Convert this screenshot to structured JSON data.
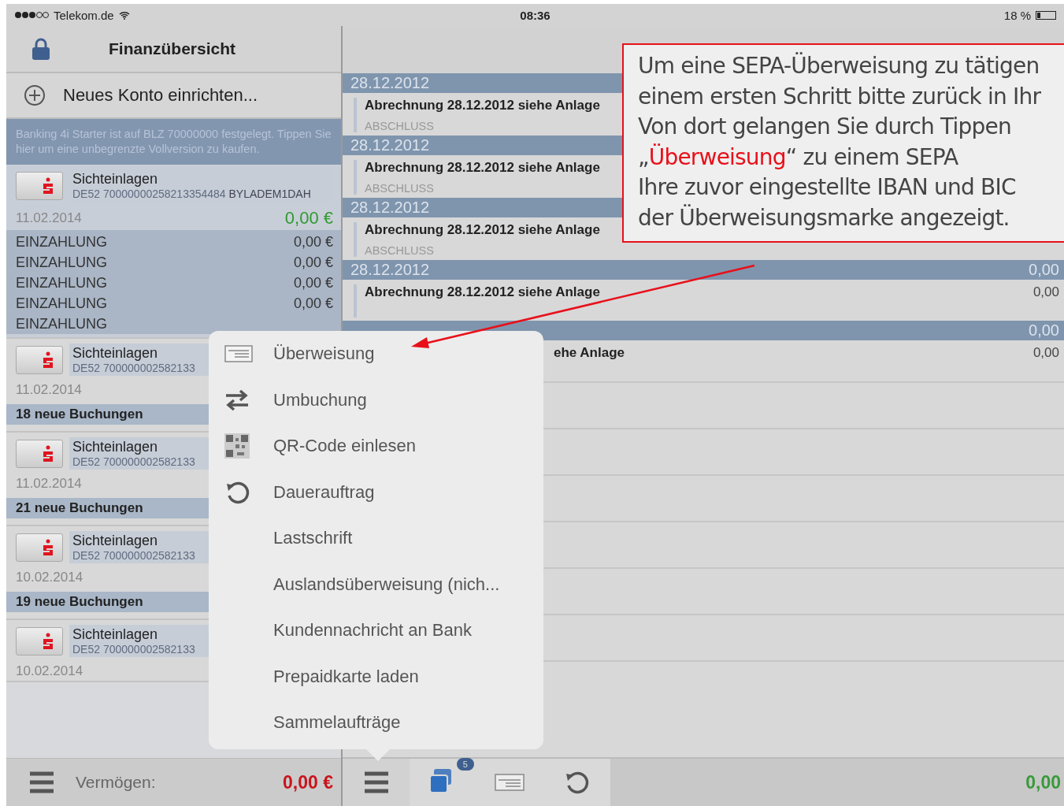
{
  "status_bar": {
    "carrier": "Telekom.de",
    "time": "08:36",
    "battery": "18 %"
  },
  "sidebar": {
    "title": "Finanzübersicht",
    "add_account": "Neues Konto einrichten...",
    "banner": "Banking 4i Starter ist auf BLZ 70000000 festgelegt. Tippen Sie hier um eine unbegrenzte Vollversion zu kaufen.",
    "accounts": [
      {
        "name": "Sichteinlagen",
        "iban": "DE52 70000000258213354484",
        "bic": "BYLADEM1DAH",
        "date": "11.02.2014",
        "balance": "0,00 €",
        "expanded": true,
        "transactions": [
          {
            "label": "EINZAHLUNG",
            "amount": "0,00 €"
          },
          {
            "label": "EINZAHLUNG",
            "amount": "0,00 €"
          },
          {
            "label": "EINZAHLUNG",
            "amount": "0,00 €"
          },
          {
            "label": "EINZAHLUNG",
            "amount": "0,00 €"
          },
          {
            "label": "EINZAHLUNG"
          }
        ]
      },
      {
        "name": "Sichteinlagen",
        "iban": "DE52 700000002582133",
        "date": "11.02.2014",
        "expanded": false,
        "new_bookings": "18 neue Buchungen"
      },
      {
        "name": "Sichteinlagen",
        "iban": "DE52 700000002582133",
        "date": "11.02.2014",
        "expanded": false,
        "new_bookings": "21 neue Buchungen"
      },
      {
        "name": "Sichteinlagen",
        "iban": "DE52 700000002582133",
        "date": "10.02.2014",
        "expanded": false,
        "new_bookings": "19 neue Buchungen"
      },
      {
        "name": "Sichteinlagen",
        "iban": "DE52 700000002582133",
        "date": "10.02.2014",
        "expanded": false
      }
    ],
    "footer": {
      "label": "Vermögen:",
      "total": "0,00 €"
    }
  },
  "main": {
    "sections": [
      {
        "date": "28.12.2012",
        "rows": [
          {
            "title": "Abrechnung 28.12.2012 siehe Anlage",
            "subtitle": "ABSCHLUSS",
            "partial": false
          }
        ]
      },
      {
        "date": "28.12.2012",
        "rows": [
          {
            "title": "Abrechnung 28.12.2012 siehe Anlage",
            "subtitle": "ABSCHLUSS",
            "partial": false
          }
        ]
      },
      {
        "date": "28.12.2012",
        "rows": [
          {
            "title": "Abrechnung 28.12.2012 siehe Anlage",
            "subtitle": "ABSCHLUSS",
            "partial": false
          }
        ]
      },
      {
        "date": "28.12.2012",
        "amount": "0,00",
        "rows": [
          {
            "title": "Abrechnung 28.12.2012 siehe Anlage",
            "amount": "0,00",
            "partial": false
          }
        ]
      },
      {
        "amount": "0,00",
        "rows": [
          {
            "title": "ehe Anlage",
            "amount": "0,00",
            "partial": true
          }
        ]
      }
    ],
    "footer": {
      "badge": "5",
      "total": "0,00"
    }
  },
  "menu": {
    "items": [
      {
        "label": "Überweisung",
        "kind": "card"
      },
      {
        "label": "Umbuchung",
        "kind": "swap"
      },
      {
        "label": "QR-Code einlesen",
        "kind": "qr"
      },
      {
        "label": "Dauerauftrag",
        "kind": "repeat"
      },
      {
        "label": "Lastschrift",
        "kind": "text"
      },
      {
        "label": "Auslandsüberweisung (nich...",
        "kind": "text"
      },
      {
        "label": "Kundennachricht an Bank",
        "kind": "text"
      },
      {
        "label": "Prepaidkarte laden",
        "kind": "text"
      },
      {
        "label": "Sammelaufträge",
        "kind": "text"
      }
    ]
  },
  "annotation": {
    "text": "Um eine SEPA-Überweisung zu tätigen\neinem ersten Schritt bitte zurück in Ihr\nVon dort gelangen Sie durch Tippen\n„**Überweisung**“ zu einem SEPA\nIhre zuvor eingestellte IBAN und BIC\nder Überweisungsmarke angezeigt."
  }
}
